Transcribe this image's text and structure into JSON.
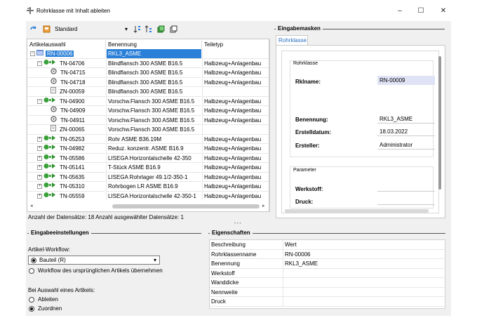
{
  "window": {
    "title": "Rohrklasse mit Inhalt ableiten",
    "minimize": "–",
    "maximize": "☐",
    "close": "✕"
  },
  "toolbar": {
    "profile_value": "Standard",
    "profile_arrow": "▾"
  },
  "grid": {
    "columns": [
      "Artikelauswahl",
      "Benennung",
      "Teiletyp"
    ],
    "rows": [
      {
        "level": 0,
        "exp": "⊟",
        "icon": "folder-icon",
        "id": "RN-00006",
        "name": "RKL3_ASME",
        "type": "",
        "selected": true
      },
      {
        "level": 1,
        "exp": "⊟",
        "icon": "assembly-icon",
        "id": "TN-04706",
        "name": "Blindflansch 300 ASME B16.5",
        "type": "Halbzeug+Anlagenbau"
      },
      {
        "level": 2,
        "exp": "",
        "icon": "part-icon",
        "id": "TN-04715",
        "name": "Blindflansch 300 ASME B16.5",
        "type": "Halbzeug+Anlagenbau"
      },
      {
        "level": 2,
        "exp": "",
        "icon": "part-icon",
        "id": "TN-04718",
        "name": "Blindflansch 300 ASME B16.5",
        "type": "Halbzeug+Anlagenbau"
      },
      {
        "level": 2,
        "exp": "",
        "icon": "doc-icon",
        "id": "ZN-00059",
        "name": "Blindflansch 300 ASME B16.5",
        "type": ""
      },
      {
        "level": 1,
        "exp": "⊟",
        "icon": "assembly-icon",
        "id": "TN-04900",
        "name": "Vorschw.Flansch 300 ASME B16.5",
        "type": "Halbzeug+Anlagenbau"
      },
      {
        "level": 2,
        "exp": "",
        "icon": "part-icon",
        "id": "TN-04909",
        "name": "Vorschw.Flansch 300 ASME B16.5",
        "type": "Halbzeug+Anlagenbau"
      },
      {
        "level": 2,
        "exp": "",
        "icon": "part-icon",
        "id": "TN-04911",
        "name": "Vorschw.Flansch 300 ASME B16.5",
        "type": "Halbzeug+Anlagenbau"
      },
      {
        "level": 2,
        "exp": "",
        "icon": "doc-icon",
        "id": "ZN-00065",
        "name": "Vorschw.Flansch 300 ASME B16.5",
        "type": ""
      },
      {
        "level": 1,
        "exp": "⊞",
        "icon": "assembly-icon",
        "id": "TN-05253",
        "name": "Rohr ASME B36.19M",
        "type": "Halbzeug+Anlagenbau"
      },
      {
        "level": 1,
        "exp": "⊞",
        "icon": "assembly-icon",
        "id": "TN-04982",
        "name": "Reduz. konzentr. ASME B16.9",
        "type": "Halbzeug+Anlagenbau"
      },
      {
        "level": 1,
        "exp": "⊞",
        "icon": "assembly-icon",
        "id": "TN-05586",
        "name": "LISEGA Horizontalschelle 42-350",
        "type": "Halbzeug+Anlagenbau"
      },
      {
        "level": 1,
        "exp": "⊞",
        "icon": "assembly-icon",
        "id": "TN-05141",
        "name": "T-Stück ASME B16.9",
        "type": "Halbzeug+Anlagenbau"
      },
      {
        "level": 1,
        "exp": "⊞",
        "icon": "assembly-icon",
        "id": "TN-05635",
        "name": "LISEGA Rohrlager 49.1/2-350-1",
        "type": "Halbzeug+Anlagenbau"
      },
      {
        "level": 1,
        "exp": "⊞",
        "icon": "assembly-icon",
        "id": "TN-05310",
        "name": "Rohrbogen LR ASME B16.9",
        "type": "Halbzeug+Anlagenbau"
      },
      {
        "level": 1,
        "exp": "⊞",
        "icon": "assembly-icon",
        "id": "TN-05559",
        "name": "LISEGA Horizontalschelle 42-350-1",
        "type": "Halbzeug+Anlagenbau"
      }
    ]
  },
  "status": {
    "text": "Anzahl der Datensätze: 18  Anzahl ausgewählter Datensätze: 1"
  },
  "masks": {
    "group_title": "Eingabemasken",
    "tab": "Rohrklasse",
    "section1": "Rohrklasse",
    "rklname_label": "Rklname:",
    "rklname_value": "RN-00009",
    "benennung_label": "Benennung:",
    "benennung_value": "RKL3_ASME",
    "erstelldatum_label": "Erstelldatum:",
    "erstelldatum_value": "18.03.2022",
    "ersteller_label": "Ersteller:",
    "ersteller_value": "Administrator",
    "section2": "Parameter",
    "werkstoff_label": "Werkstoff:",
    "druck_label": "Druck:"
  },
  "settings": {
    "group_title": "Eingabeeinstellungen",
    "workflow_label": "Artikel-Workflow:",
    "opt_bauteil": "Bauteil (R)",
    "opt_orig": "Workflow des ursprünglichen Artikels übernehmen",
    "auswahl_label": "Bei Auswahl eines Artikels:",
    "opt_ableiten": "Ableiten",
    "opt_zuordnen": "Zuordnen"
  },
  "props": {
    "group_title": "Eigenschaften",
    "col1": "Beschreibung",
    "col2": "Wert",
    "rows": [
      {
        "k": "Rohrklassenname",
        "v": "RN-00006"
      },
      {
        "k": "Benennung",
        "v": "RKL3_ASME"
      },
      {
        "k": "Werkstoff",
        "v": ""
      },
      {
        "k": "Wanddicke",
        "v": ""
      },
      {
        "k": "Nennweite",
        "v": ""
      },
      {
        "k": "Druck",
        "v": ""
      }
    ]
  },
  "colors": {
    "selection": "#2a7fd8",
    "tab_text": "#2a6fc0",
    "highlight_field": "#dfe3f5"
  }
}
